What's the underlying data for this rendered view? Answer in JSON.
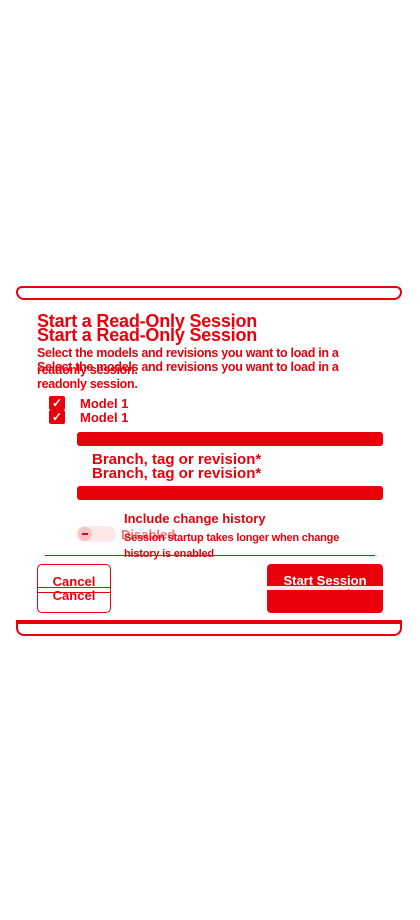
{
  "dialog": {
    "title": "Start a Read-Only Session",
    "description": "Select the models and revisions you want to load in a readonly session.",
    "models": [
      {
        "label": "Model 1",
        "checked": true
      }
    ],
    "revision_input": {
      "label": "Branch, tag or revision*",
      "value": ""
    },
    "change_history": {
      "label": "Include change history",
      "state_label": "Disabled",
      "enabled": false,
      "helper": "Session startup takes longer when change history is enabled"
    },
    "buttons": {
      "cancel": "Cancel",
      "start": "Start Session"
    }
  },
  "colors": {
    "accent": "#e8000b"
  }
}
